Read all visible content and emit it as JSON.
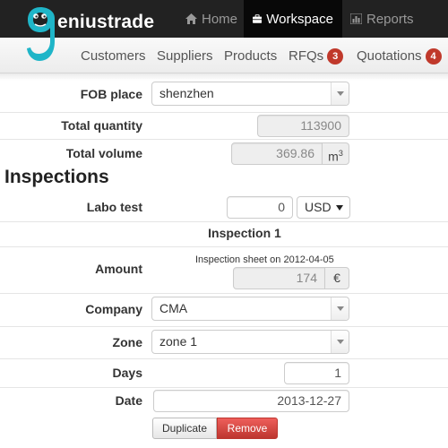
{
  "brand": {
    "name": "eniustrade",
    "color": "#1fb5c8"
  },
  "topnav": [
    {
      "label": "Home",
      "icon": "home-icon"
    },
    {
      "label": "Workspace",
      "icon": "briefcase-icon",
      "active": true
    },
    {
      "label": "Reports",
      "icon": "bar-chart-icon"
    }
  ],
  "subnav": [
    {
      "label": "Customers"
    },
    {
      "label": "Suppliers"
    },
    {
      "label": "Products"
    },
    {
      "label": "RFQs",
      "badge": "3"
    },
    {
      "label": "Quotations",
      "badge": "4"
    }
  ],
  "form": {
    "fob_place": {
      "label": "FOB place",
      "value": "shenzhen"
    },
    "total_quantity": {
      "label": "Total quantity",
      "value": "113900"
    },
    "total_volume": {
      "label": "Total volume",
      "value": "369.86",
      "unit": "m",
      "unit_sup": "3"
    }
  },
  "inspections": {
    "title": "Inspections",
    "labo_test": {
      "label": "Labo test",
      "value": "0",
      "currency": "USD"
    },
    "inspection": {
      "heading": "Inspection 1",
      "amount": {
        "label": "Amount",
        "note": "Inspection sheet on 2012-04-05",
        "value": "174",
        "unit": "€"
      },
      "company": {
        "label": "Company",
        "value": "CMA"
      },
      "zone": {
        "label": "Zone",
        "value": "zone 1"
      },
      "days": {
        "label": "Days",
        "value": "1"
      },
      "date": {
        "label": "Date",
        "value": "2013-12-27"
      },
      "duplicate_label": "Duplicate",
      "remove_label": "Remove"
    }
  }
}
